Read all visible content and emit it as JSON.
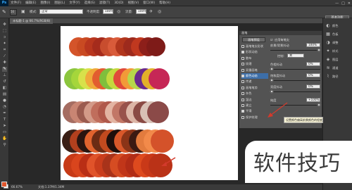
{
  "app": {
    "logo": "Ps"
  },
  "menu": [
    "文件(F)",
    "编辑(E)",
    "图像(I)",
    "图层(L)",
    "文字(Y)",
    "选择(S)",
    "滤镜(T)",
    "3D(D)",
    "视图(V)",
    "窗口(W)",
    "帮助(H)"
  ],
  "window_controls": {
    "minimize": "—",
    "maximize": "□",
    "close": "✕"
  },
  "options_bar": {
    "brush_size": "50",
    "mode_label": "模式:",
    "mode_value": "正常",
    "opacity_label": "不透明度:",
    "opacity_value": "100%",
    "flow_label": "流量:",
    "flow_value": "100%",
    "workspace": "基本功能"
  },
  "document_tab": {
    "title": "未标题-1 @ 66.7%(RGB/8)"
  },
  "status_bar": {
    "zoom": "66.67%",
    "doc": "文档:1.37M/1.34M"
  },
  "brush_panel": {
    "header": "画笔",
    "presets_button": "画笔预设",
    "items": [
      {
        "label": "画笔笔尖形状",
        "checked": false
      },
      {
        "label": "形状动态",
        "checked": true
      },
      {
        "label": "散布",
        "checked": false
      },
      {
        "label": "纹理",
        "checked": false
      },
      {
        "label": "双重画笔",
        "checked": false
      },
      {
        "label": "颜色动态",
        "checked": true,
        "active": true
      },
      {
        "label": "传递",
        "checked": false
      },
      {
        "label": "画笔笔势",
        "checked": false
      },
      {
        "label": "杂色",
        "checked": false
      },
      {
        "label": "湿边",
        "checked": false
      },
      {
        "label": "建立",
        "checked": false
      },
      {
        "label": "平滑",
        "checked": true
      },
      {
        "label": "保护纹理",
        "checked": false
      }
    ],
    "apply_per_tip": "应用每笔尖",
    "fg_bg_jitter_label": "前景/背景抖动",
    "fg_bg_jitter_value": "100%",
    "control_label": "控制:",
    "control_value": "关",
    "hue_jitter_label": "色相抖动",
    "hue_jitter_value": "0%",
    "saturation_jitter_label": "饱和度抖动",
    "saturation_jitter_value": "0%",
    "brightness_jitter_label": "亮度抖动",
    "brightness_jitter_value": "0%",
    "purity_label": "纯度",
    "purity_value": "+100%"
  },
  "tooltip": "设置颜色偏离前景颜色的程度",
  "right_dock": [
    "颜色",
    "色板",
    "调整",
    "样式",
    "图层",
    "通道",
    "路径"
  ],
  "watermark": "软件技巧",
  "canvas_strokes": [
    {
      "colors": [
        "#d4542a",
        "#c94a22",
        "#b8361e",
        "#a52b1c",
        "#c84d2e",
        "#d95b3a",
        "#b1361d",
        "#9d2a1d",
        "#c0381f",
        "#8d1f1a",
        "#7e1b18"
      ]
    },
    {
      "colors": [
        "#8cc63e",
        "#a5d63b",
        "#d8e14a",
        "#f0a93a",
        "#e25d2f",
        "#7fbf3c",
        "#c5d83d",
        "#e0493a",
        "#f29a38",
        "#b6d74a",
        "#6a2a8c",
        "#e2b02a",
        "#c62756"
      ]
    },
    {
      "colors": [
        "#a56d62",
        "#c98573",
        "#9b5b4f",
        "#d39a88",
        "#c06e5c",
        "#b0584a",
        "#e3b4a2",
        "#c27766",
        "#98524b",
        "#dcb5a6",
        "#8a4a44",
        "#d8c1b6",
        "#8b4a48"
      ]
    },
    {
      "colors": [
        "#3a1f16",
        "#b2401e",
        "#2a1510",
        "#e0632e",
        "#6b2b14",
        "#c14a1f",
        "#1f0f0b",
        "#d8582a",
        "#8a3417",
        "#3b1a12",
        "#e27b3e",
        "#f28a4a",
        "#d4522a"
      ]
    },
    {
      "colors": [
        "#c73a17",
        "#d9451d",
        "#b92e15",
        "#e0532a",
        "#c93d1c",
        "#a8331a",
        "#d64c22",
        "#c13619",
        "#b12c16",
        "#de4a1e",
        "#c93918",
        "#ba3217"
      ]
    }
  ]
}
